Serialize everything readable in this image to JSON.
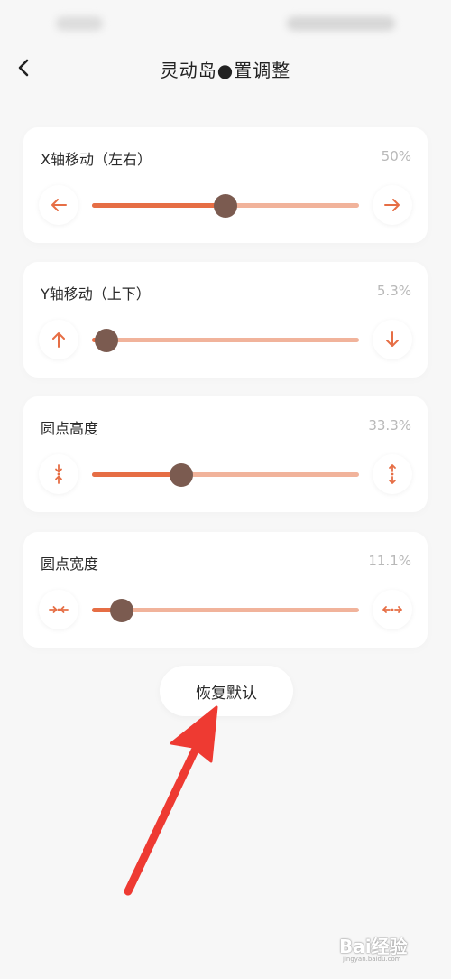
{
  "header": {
    "title": "灵动岛●置调整",
    "back_icon": "chevron-left-icon"
  },
  "sliders": [
    {
      "label": "X轴移动（左右）",
      "value_text": "50%",
      "value": 0.5,
      "left_icon": "arrow-left-icon",
      "right_icon": "arrow-right-icon"
    },
    {
      "label": "Y轴移动（上下）",
      "value_text": "5.3%",
      "value": 0.053,
      "left_icon": "arrow-up-icon",
      "right_icon": "arrow-down-icon"
    },
    {
      "label": "圆点高度",
      "value_text": "33.3%",
      "value": 0.333,
      "left_icon": "shrink-vertical-icon",
      "right_icon": "expand-vertical-icon"
    },
    {
      "label": "圆点宽度",
      "value_text": "11.1%",
      "value": 0.111,
      "left_icon": "shrink-horizontal-icon",
      "right_icon": "expand-horizontal-icon"
    }
  ],
  "reset_label": "恢复默认",
  "watermark": {
    "text": "Bai经验",
    "url": "jingyan.baidu.com"
  },
  "colors": {
    "accent": "#e66e45",
    "track": "#f1b39b",
    "thumb": "#7b5b50",
    "annotation_arrow": "#ee3a32"
  }
}
